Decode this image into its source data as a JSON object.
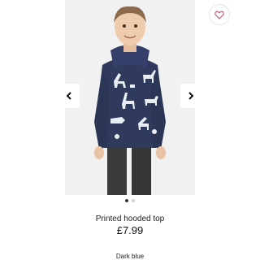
{
  "product": {
    "title": "Printed hooded top",
    "price": "£7.99",
    "color": "Dark blue",
    "image_icon": "product-photo",
    "gallery": {
      "total_images": 2,
      "active_index": 0
    }
  },
  "icons": {
    "favorite": "heart-outline-icon",
    "prev": "chevron-left-icon",
    "next": "chevron-right-icon"
  },
  "colors": {
    "accent_heart": "#c2547a",
    "hoodie": "#2f3a5c",
    "pants": "#3b3b3b",
    "background": "#f1f1f1"
  }
}
